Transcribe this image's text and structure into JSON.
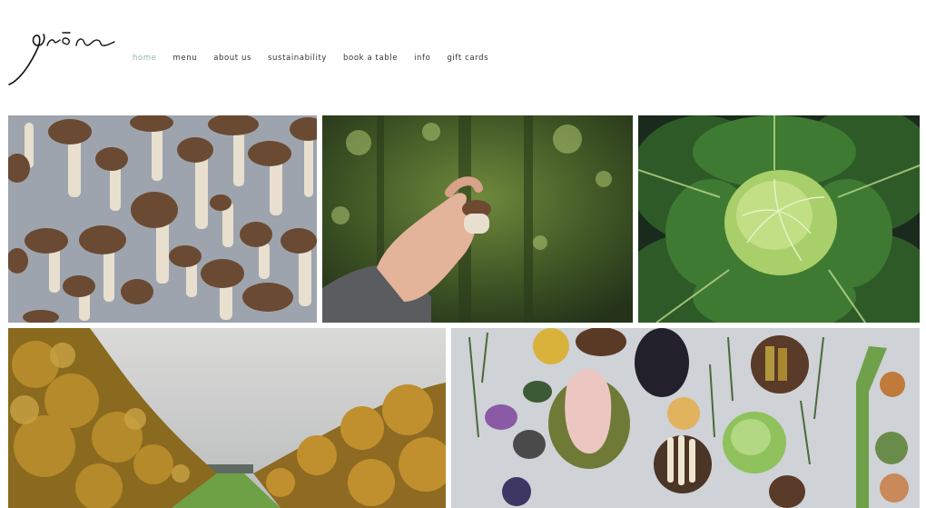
{
  "brand": {
    "logo_text": "grön"
  },
  "nav": [
    {
      "label": "home",
      "active": true
    },
    {
      "label": "menu",
      "active": false
    },
    {
      "label": "about us",
      "active": false
    },
    {
      "label": "sustainability",
      "active": false
    },
    {
      "label": "book a table",
      "active": false
    },
    {
      "label": "info",
      "active": false
    },
    {
      "label": "gift cards",
      "active": false
    }
  ],
  "colors": {
    "active_nav": "#8bb5a6",
    "nav_text": "#333333",
    "background": "#ffffff"
  },
  "gallery": [
    {
      "name": "mushrooms-on-linen"
    },
    {
      "name": "hand-holding-mushroom-in-forest"
    },
    {
      "name": "savoy-cabbage"
    },
    {
      "name": "autumn-orchard-rows"
    },
    {
      "name": "ingredients-flatlay"
    }
  ]
}
